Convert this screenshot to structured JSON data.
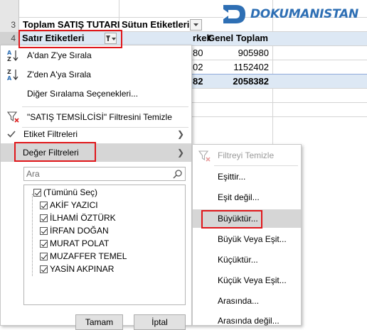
{
  "sheet": {
    "row_numbers": [
      "3",
      "4"
    ],
    "pivot_value_header": "Toplam SATIŞ TUTARI",
    "column_labels_header": "Sütun Etiketleri",
    "row_labels_header": "Satır Etiketleri",
    "column_partial_header": "rkek",
    "grand_total_header": "Genel Toplam",
    "partial_values": [
      "80",
      "02",
      "82"
    ],
    "grand_totals": [
      "905980",
      "1152402",
      "2058382"
    ]
  },
  "logo": {
    "text": "DOKUMANISTAN",
    "brand_color": "#2e6fb4"
  },
  "filter_menu": {
    "sort_az": "A'dan Z'ye Sırala",
    "sort_za": "Z'den A'ya Sırala",
    "more_sort": "Diğer Sıralama Seçenekleri...",
    "clear_filter": "\"SATIŞ TEMSİLCİSİ\" Filtresini Temizle",
    "label_filters": "Etiket Filtreleri",
    "value_filters": "Değer Filtreleri",
    "search_placeholder": "Ara",
    "items": [
      "(Tümünü Seç)",
      "AKİF YAZICI",
      "İLHAMİ ÖZTÜRK",
      "İRFAN DOĞAN",
      "MURAT POLAT",
      "MUZAFFER TEMEL",
      "YASİN AKPINAR"
    ],
    "ok": "Tamam",
    "cancel": "İptal"
  },
  "value_submenu": {
    "clear": "Filtreyi Temizle",
    "items": [
      "Eşittir...",
      "Eşit değil...",
      "Büyüktür...",
      "Büyük Veya Eşit...",
      "Küçüktür...",
      "Küçük Veya Eşit...",
      "Arasında...",
      "Arasında değil..."
    ]
  },
  "highlight_color": "#e0171b"
}
